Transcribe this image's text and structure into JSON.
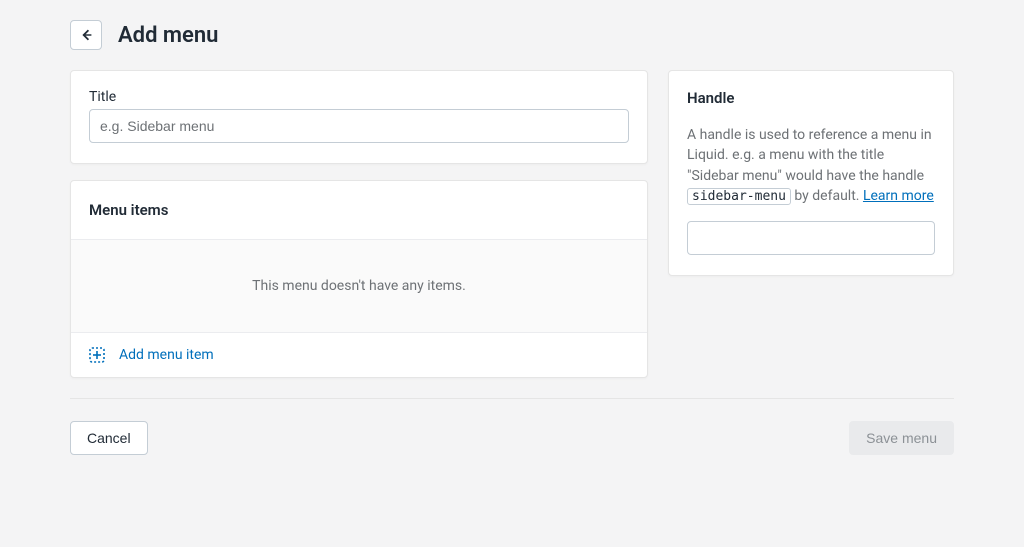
{
  "header": {
    "page_title": "Add menu"
  },
  "title_card": {
    "label": "Title",
    "placeholder": "e.g. Sidebar menu",
    "value": ""
  },
  "menu_items": {
    "heading": "Menu items",
    "empty_text": "This menu doesn't have any items.",
    "add_label": "Add menu item"
  },
  "handle": {
    "heading": "Handle",
    "desc_before": "A handle is used to reference a menu in Liquid. e.g. a menu with the title \"Sidebar menu\" would have the handle ",
    "code": "sidebar-menu",
    "desc_after": " by default. ",
    "learn_more": "Learn more",
    "value": ""
  },
  "footer": {
    "cancel": "Cancel",
    "save": "Save menu"
  }
}
